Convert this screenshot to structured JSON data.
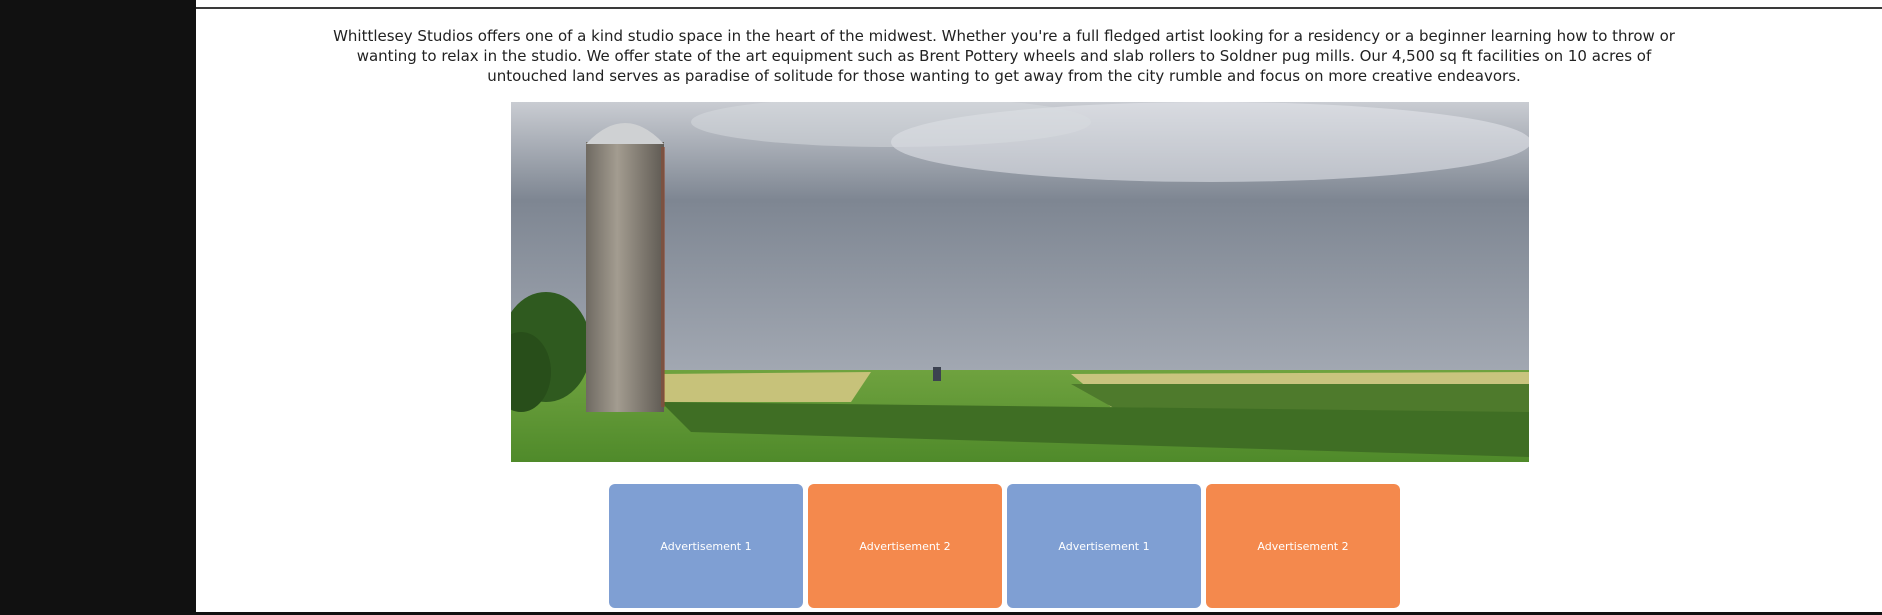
{
  "intro_text": "Whittlesey Studios offers one of a kind studio space in the heart of the midwest. Whether you're a full fledged artist looking for a residency or a beginner learning how to throw or wanting to relax in the studio. We offer state of the art equipment such as Brent Pottery wheels and slab rollers to Soldner pug mills. Our 4,500 sq ft facilities on 10 acres of untouched land serves as paradise of solitude for those wanting to get away from the city rumble and focus on more creative endeavors.",
  "hero_image": "farm-landscape-with-silo",
  "ads": [
    {
      "label": "Advertisement 1",
      "color": "#7f9fd3"
    },
    {
      "label": "Advertisement 2",
      "color": "#f4894d"
    },
    {
      "label": "Advertisement 1",
      "color": "#7f9fd3"
    },
    {
      "label": "Advertisement 2",
      "color": "#f4894d"
    }
  ],
  "colors": {
    "sidebar": "#111111",
    "ad_blue": "#7f9fd3",
    "ad_orange": "#f4894d"
  }
}
